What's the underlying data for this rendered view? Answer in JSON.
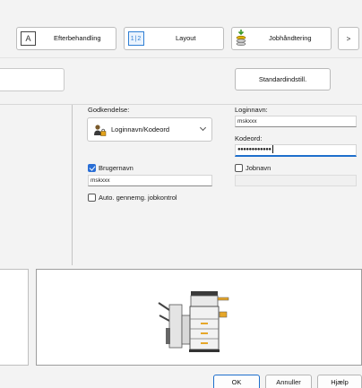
{
  "tabs": [
    {
      "label": "Efterbehandling",
      "icon": "letter-a-icon"
    },
    {
      "label": "Layout",
      "icon": "layout-12-icon",
      "icon_text": "1|2"
    },
    {
      "label": "Jobhåndtering",
      "icon": "job-handling-icon"
    },
    {
      "label": ">",
      "icon": "chevron-right-icon"
    }
  ],
  "toolbar": {
    "defaults_button": "Standardindstill."
  },
  "auth": {
    "label": "Godkendelse:",
    "selected": "Loginnavn/Kodeord"
  },
  "login": {
    "label": "Loginnavn:",
    "value": "mskxxx"
  },
  "password": {
    "label": "Kodeord:",
    "value": "●●●●●●●●●●●●"
  },
  "username": {
    "label": "Brugernavn",
    "checked": true,
    "value": "mskxxx"
  },
  "jobname": {
    "label": "Jobnavn",
    "checked": false,
    "value": ""
  },
  "auto_job_control": {
    "label": "Auto. gennemg. jobkontrol",
    "checked": false
  },
  "footer": {
    "ok": "OK",
    "cancel": "Annuller",
    "help": "Hjælp"
  },
  "colors": {
    "accent": "#1e6fcc",
    "background": "#f3f3f3"
  }
}
